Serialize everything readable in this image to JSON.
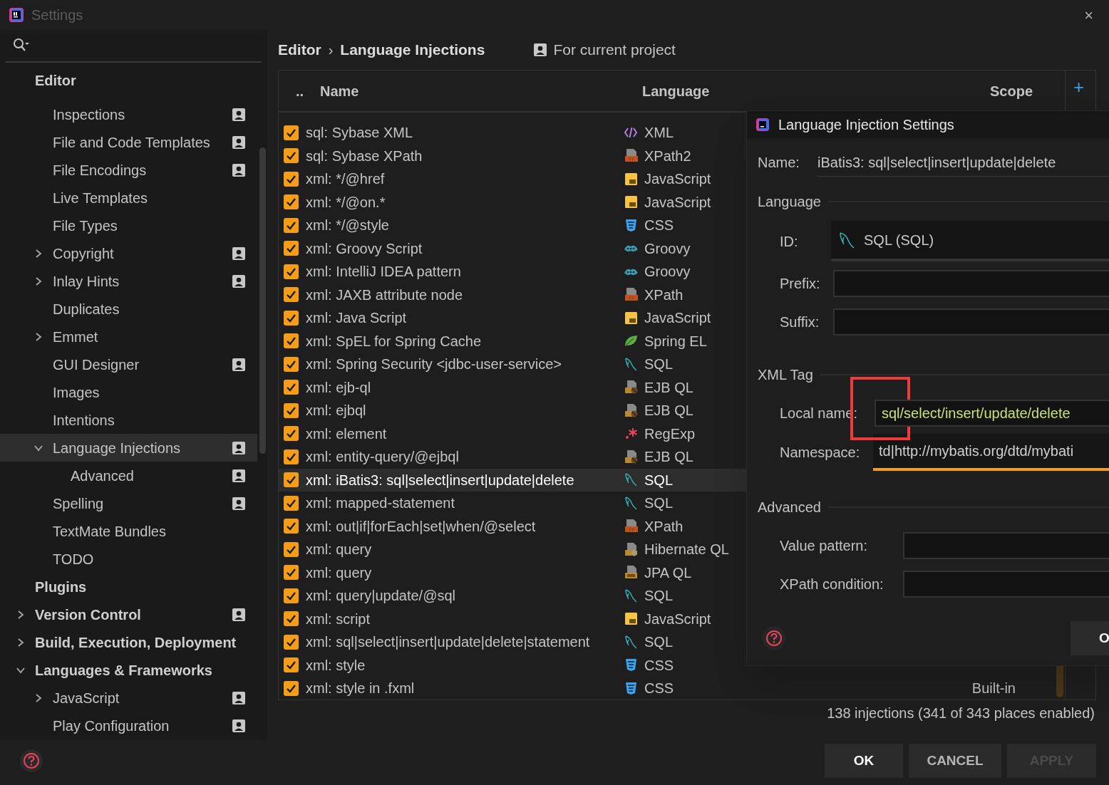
{
  "window": {
    "title": "Settings",
    "close": "×"
  },
  "sidebar": {
    "items": [
      {
        "label": "Editor",
        "kind": "heading",
        "project_level": false,
        "selected": false,
        "children": [
          {
            "label": "Inspections",
            "project_level": true,
            "selected": false
          },
          {
            "label": "File and Code Templates",
            "project_level": true,
            "selected": false
          },
          {
            "label": "File Encodings",
            "project_level": true,
            "selected": false
          },
          {
            "label": "Live Templates",
            "project_level": false,
            "selected": false
          },
          {
            "label": "File Types",
            "project_level": false,
            "selected": false
          },
          {
            "label": "Copyright",
            "expanded": false,
            "project_level": true,
            "selected": false
          },
          {
            "label": "Inlay Hints",
            "expanded": false,
            "project_level": true,
            "selected": false
          },
          {
            "label": "Duplicates",
            "project_level": false,
            "selected": false
          },
          {
            "label": "Emmet",
            "expanded": false,
            "project_level": false,
            "selected": false
          },
          {
            "label": "GUI Designer",
            "project_level": true,
            "selected": false
          },
          {
            "label": "Images",
            "project_level": false,
            "selected": false
          },
          {
            "label": "Intentions",
            "project_level": false,
            "selected": false
          },
          {
            "label": "Language Injections",
            "expanded": true,
            "project_level": true,
            "selected": true,
            "children": [
              {
                "label": "Advanced",
                "project_level": true,
                "selected": false
              }
            ]
          },
          {
            "label": "Spelling",
            "project_level": true,
            "selected": false
          },
          {
            "label": "TextMate Bundles",
            "project_level": false,
            "selected": false
          },
          {
            "label": "TODO",
            "project_level": false,
            "selected": false
          }
        ]
      },
      {
        "label": "Plugins",
        "kind": "heading",
        "project_level": false,
        "selected": false
      },
      {
        "label": "Version Control",
        "kind": "heading",
        "expanded": false,
        "project_level": true,
        "selected": false
      },
      {
        "label": "Build, Execution, Deployment",
        "kind": "heading",
        "expanded": false,
        "project_level": false,
        "selected": false
      },
      {
        "label": "Languages & Frameworks",
        "kind": "heading",
        "expanded": true,
        "project_level": false,
        "selected": false,
        "children": [
          {
            "label": "JavaScript",
            "expanded": false,
            "project_level": true,
            "selected": false
          },
          {
            "label": "Play Configuration",
            "project_level": true,
            "selected": false
          }
        ]
      }
    ]
  },
  "breadcrumb": [
    "Editor",
    "Language Injections"
  ],
  "breadcrumb_separator": "›",
  "scope_toggle": "For current project",
  "table": {
    "columns": [
      "..",
      "Name",
      "Language",
      "Scope"
    ],
    "add_button": "+",
    "rows": [
      {
        "name": "sql: Sybase XML",
        "checked": true,
        "language": "XML",
        "kind": "xml",
        "selected": false
      },
      {
        "name": "sql: Sybase XPath",
        "checked": true,
        "language": "XPath2",
        "kind": "xpath",
        "selected": false
      },
      {
        "name": "xml: */@href",
        "checked": true,
        "language": "JavaScript",
        "kind": "js",
        "selected": false
      },
      {
        "name": "xml: */@on.*",
        "checked": true,
        "language": "JavaScript",
        "kind": "js",
        "selected": false
      },
      {
        "name": "xml: */@style",
        "checked": true,
        "language": "CSS",
        "kind": "css",
        "selected": false
      },
      {
        "name": "xml: Groovy Script",
        "checked": true,
        "language": "Groovy",
        "kind": "groovy",
        "selected": false
      },
      {
        "name": "xml: IntelliJ IDEA pattern",
        "checked": true,
        "language": "Groovy",
        "kind": "groovy",
        "selected": false
      },
      {
        "name": "xml: JAXB attribute node",
        "checked": true,
        "language": "XPath",
        "kind": "xpath",
        "selected": false
      },
      {
        "name": "xml: Java Script",
        "checked": true,
        "language": "JavaScript",
        "kind": "js",
        "selected": false
      },
      {
        "name": "xml: SpEL for Spring Cache",
        "checked": true,
        "language": "Spring EL",
        "kind": "spring",
        "selected": false
      },
      {
        "name": "xml: Spring Security <jdbc-user-service>",
        "checked": true,
        "language": "SQL",
        "kind": "sql",
        "selected": false
      },
      {
        "name": "xml: ejb-ql",
        "checked": true,
        "language": "EJB QL",
        "kind": "ejbql",
        "selected": false
      },
      {
        "name": "xml: ejbql",
        "checked": true,
        "language": "EJB QL",
        "kind": "ejbql",
        "selected": false
      },
      {
        "name": "xml: element",
        "checked": true,
        "language": "RegExp",
        "kind": "regexp",
        "selected": false
      },
      {
        "name": "xml: entity-query/@ejbql",
        "checked": true,
        "language": "EJB QL",
        "kind": "ejbql",
        "selected": false
      },
      {
        "name": "xml: iBatis3: sql|select|insert|update|delete",
        "checked": true,
        "language": "SQL",
        "kind": "sql",
        "selected": true
      },
      {
        "name": "xml: mapped-statement",
        "checked": true,
        "language": "SQL",
        "kind": "sql",
        "selected": false
      },
      {
        "name": "xml: out|if|forEach|set|when/@select",
        "checked": true,
        "language": "XPath",
        "kind": "xpath",
        "selected": false
      },
      {
        "name": "xml: query",
        "checked": true,
        "language": "Hibernate QL",
        "kind": "hibernate",
        "selected": false
      },
      {
        "name": "xml: query",
        "checked": true,
        "language": "JPA QL",
        "kind": "jpaql",
        "selected": false
      },
      {
        "name": "xml: query|update/@sql",
        "checked": true,
        "language": "SQL",
        "kind": "sql",
        "selected": false
      },
      {
        "name": "xml: script",
        "checked": true,
        "language": "JavaScript",
        "kind": "js",
        "selected": false
      },
      {
        "name": "xml: sql|select|insert|update|delete|statement",
        "checked": true,
        "language": "SQL",
        "kind": "sql",
        "selected": false
      },
      {
        "name": "xml: style",
        "checked": true,
        "language": "CSS",
        "kind": "css",
        "selected": false
      },
      {
        "name": "xml: style in .fxml",
        "checked": true,
        "language": "CSS",
        "kind": "css",
        "selected": false,
        "scope": "Built-in"
      }
    ]
  },
  "status": "138 injections (341 of 343 places enabled)",
  "buttons": [
    {
      "label": "OK",
      "disabled": false
    },
    {
      "label": "CANCEL",
      "disabled": false
    },
    {
      "label": "APPLY",
      "disabled": true
    }
  ],
  "dialog": {
    "title": "Language Injection Settings",
    "name_label": "Name:",
    "name_value": "iBatis3: sql|select|insert|update|delete",
    "language_section": "Language",
    "id_label": "ID:",
    "id_value": "SQL (SQL)",
    "prefix_label": "Prefix:",
    "suffix_label": "Suffix:",
    "xml_section": "XML Tag",
    "local_name_label": "Local name:",
    "local_name_value": "sql/select/insert/update/delete",
    "namespace_label": "Namespace:",
    "namespace_value": "td|http://mybatis.org/dtd/mybati",
    "advanced_section": "Advanced",
    "value_pattern_label": "Value pattern:",
    "xpath_label": "XPath condition:",
    "ok_button": "O"
  }
}
